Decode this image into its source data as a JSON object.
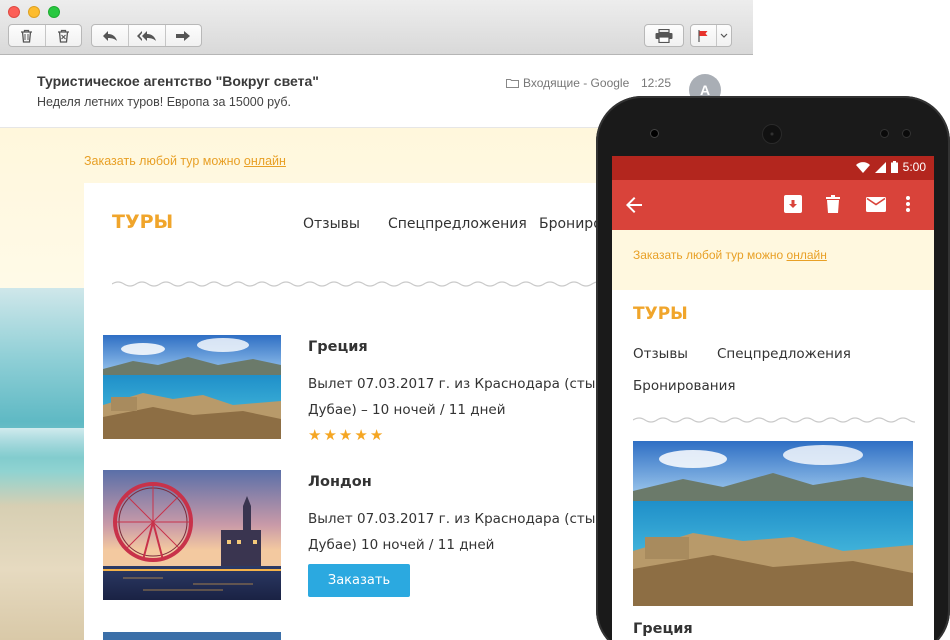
{
  "window": {
    "toolbar": {
      "buttons": [
        "trash-icon",
        "junk-icon",
        "reply-icon",
        "reply-all-icon",
        "forward-icon",
        "print-icon",
        "flag-icon",
        "chevron-down-icon"
      ]
    }
  },
  "mail": {
    "from": "Туристическое агентство \"Вокруг света\"",
    "subject": "Неделя летних туров! Европа за 15000 руб.",
    "folder": "Входящие - Google",
    "time": "12:25",
    "avatar_letter": "A"
  },
  "newsletter": {
    "preheader_text": "Заказать любой тур можно",
    "preheader_link": "онлайн",
    "logo": "ТУРЫ",
    "nav": [
      "Отзывы",
      "Спецпредложения",
      "Бронирования"
    ],
    "tours": [
      {
        "title": "Греция",
        "desc_line1": "Вылет 07.03.2017 г. из Краснодара (стыковка в",
        "desc_line2": "Дубае) – 10 ночей / 11 дней",
        "rating": 5
      },
      {
        "title": "Лондон",
        "desc_line1": "Вылет 07.03.2017 г. из Краснодара (стыковка в",
        "desc_line2": "Дубае) 10 ночей / 11 дней",
        "button_label": "Заказать"
      }
    ]
  },
  "phone": {
    "status": {
      "time": "5:00"
    },
    "appbar_icons": [
      "back-arrow-icon",
      "archive-icon",
      "trash-icon",
      "mail-icon",
      "more-vert-icon"
    ],
    "preheader_text": "Заказать любой тур можно",
    "preheader_link": "онлайн",
    "logo": "ТУРЫ",
    "nav_line1_a": "Отзывы",
    "nav_line1_b": "Спецпредложения",
    "nav_line2": "Бронирования",
    "tour_title": "Греция"
  },
  "colors": {
    "accent_orange": "#f0a52b",
    "button_blue": "#2ba9e0",
    "gmail_red": "#d9433a",
    "gmail_status_red": "#b3261e"
  }
}
